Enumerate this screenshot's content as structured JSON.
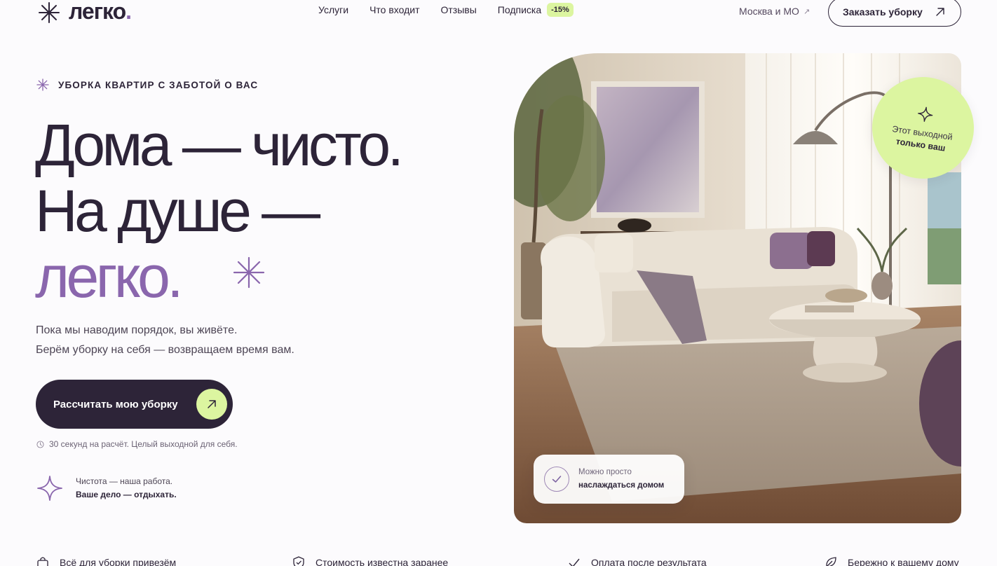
{
  "brand": {
    "name": "легко",
    "dot": "."
  },
  "nav": {
    "items": [
      {
        "label": "Услуги"
      },
      {
        "label": "Что входит"
      },
      {
        "label": "Отзывы"
      }
    ],
    "subscription": {
      "label": "Подписка",
      "badge": "-15%"
    },
    "city": {
      "label": "Москва и МО",
      "arrow": "↗"
    },
    "order_button": "Заказать уборку"
  },
  "hero": {
    "kicker": "УБОРКА КВАРТИР С ЗАБОТОЙ О ВАС",
    "headline": {
      "line1": "Дома — чисто.",
      "line2": "На душе —",
      "line3": "легко."
    },
    "lead": {
      "line1": "Пока мы наводим порядок, вы живёте.",
      "line2": "Берём уборку на себя — возвращаем время вам."
    },
    "cta_label": "Рассчитать мою уборку",
    "note": "30 секунд на расчёт. Целый выходной для себя.",
    "promise": {
      "line1": "Чистота — наша работа.",
      "line2": "Ваше дело — отдыхать."
    }
  },
  "image_overlay": {
    "card_line1": "Можно просто",
    "card_line2": "наслаждаться домом",
    "bubble_line1": "Этот выходной",
    "bubble_line2": "только ваш"
  },
  "benefits": [
    {
      "icon": "bag-icon",
      "label": "Всё для уборки привезём"
    },
    {
      "icon": "shield-check-icon",
      "label": "Стоимость известна заранее"
    },
    {
      "icon": "check-icon",
      "label": "Оплата после результата"
    },
    {
      "icon": "leaf-icon",
      "label": "Бережно к вашему дому"
    }
  ],
  "colors": {
    "background": "#fcfbfd",
    "ink": "#2d2438",
    "accent_purple": "#8a66ad",
    "accent_lime": "#dcf5a0"
  }
}
